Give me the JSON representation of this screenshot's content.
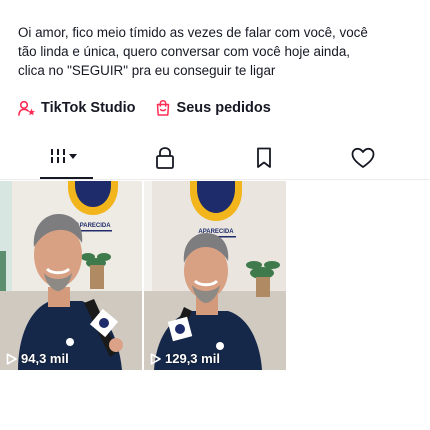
{
  "bio": {
    "lines": [
      "Oi amor, fico meio tímido as vezes de falar com você, você",
      "tão linda e única, quero conversar com você hoje ainda,",
      "clica no \"SEGUIR\" pra eu conseguir te ligar"
    ]
  },
  "links": {
    "studio_label": "TikTok Studio",
    "orders_label": "Seus pedidos"
  },
  "tabs": [
    {
      "name": "videos",
      "icon": "grid-bars-icon",
      "active": true
    },
    {
      "name": "private",
      "icon": "lock-icon",
      "active": false
    },
    {
      "name": "favorites",
      "icon": "bookmark-icon",
      "active": false
    },
    {
      "name": "liked",
      "icon": "heart-icon",
      "active": false
    }
  ],
  "videos": [
    {
      "views": "94,3 mil",
      "logo_text": "APARECIDA"
    },
    {
      "views": "129,3 mil",
      "logo_text": "APARECIDA"
    }
  ],
  "colors": {
    "text": "#161823",
    "accent": "#fe2c55",
    "logo_yellow": "#f2b51b",
    "logo_navy": "#1e2c6b"
  }
}
